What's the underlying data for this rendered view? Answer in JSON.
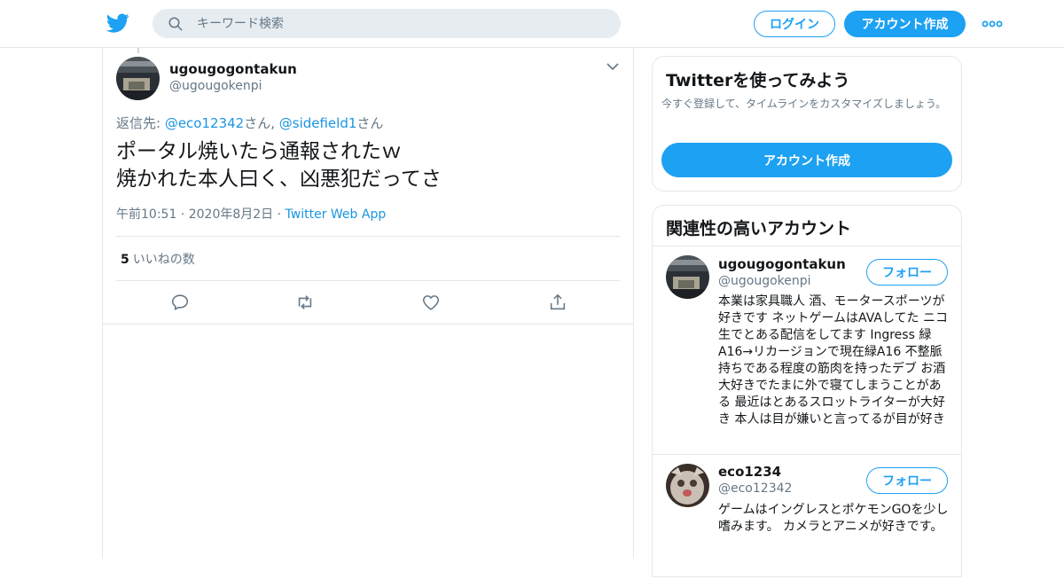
{
  "header": {
    "search_placeholder": "キーワード検索",
    "login_label": "ログイン",
    "signup_label": "アカウント作成",
    "icons": [
      "twitter-bird-icon",
      "search-icon",
      "more-icon"
    ],
    "brand_color": "#1da1f2"
  },
  "tweet": {
    "author_name": "ugougogontakun",
    "author_handle": "@ugougokenpi",
    "reply_prefix": "返信先: ",
    "reply_user1": "@eco12342",
    "reply_san1": "さん, ",
    "reply_user2": "@sidefield1",
    "reply_san2": "さん",
    "text_line1": "ポータル焼いたら通報されたｗ",
    "text_line2": "焼かれた本人曰く、凶悪犯だってさ",
    "time": "午前10:51",
    "date": "2020年8月2日",
    "source": "Twitter Web App",
    "likes_count": "5",
    "likes_label": "いいねの数",
    "actions": [
      "reply-icon",
      "retweet-icon",
      "like-icon",
      "share-icon"
    ]
  },
  "sidebar": {
    "signup_card": {
      "title": "Twitterを使ってみよう",
      "description": "今すぐ登録して、タイムラインをカスタマイズしましょう。",
      "button_label": "アカウント作成"
    },
    "related": {
      "title": "関連性の高いアカウント",
      "accounts": [
        {
          "name": "ugougogontakun",
          "handle": "@ugougokenpi",
          "follow_label": "フォロー",
          "bio": "本業は家具職人 酒、モータースポーツが好きです ネットゲームはAVAしてた ニコ生でとある配信をしてます Ingress 緑 A16→リカージョンで現在緑A16 不整脈持ちである程度の筋肉を持ったデブ お酒大好きでたまに外で寝てしまうことがある 最近はとあるスロットライターが大好き 本人は目が嫌いと言ってるが目が好き"
        },
        {
          "name": "eco1234",
          "handle": "@eco12342",
          "follow_label": "フォロー",
          "bio": "ゲームはイングレスとポケモンGOを少し嗜みます。 カメラとアニメが好きです。"
        }
      ]
    }
  }
}
